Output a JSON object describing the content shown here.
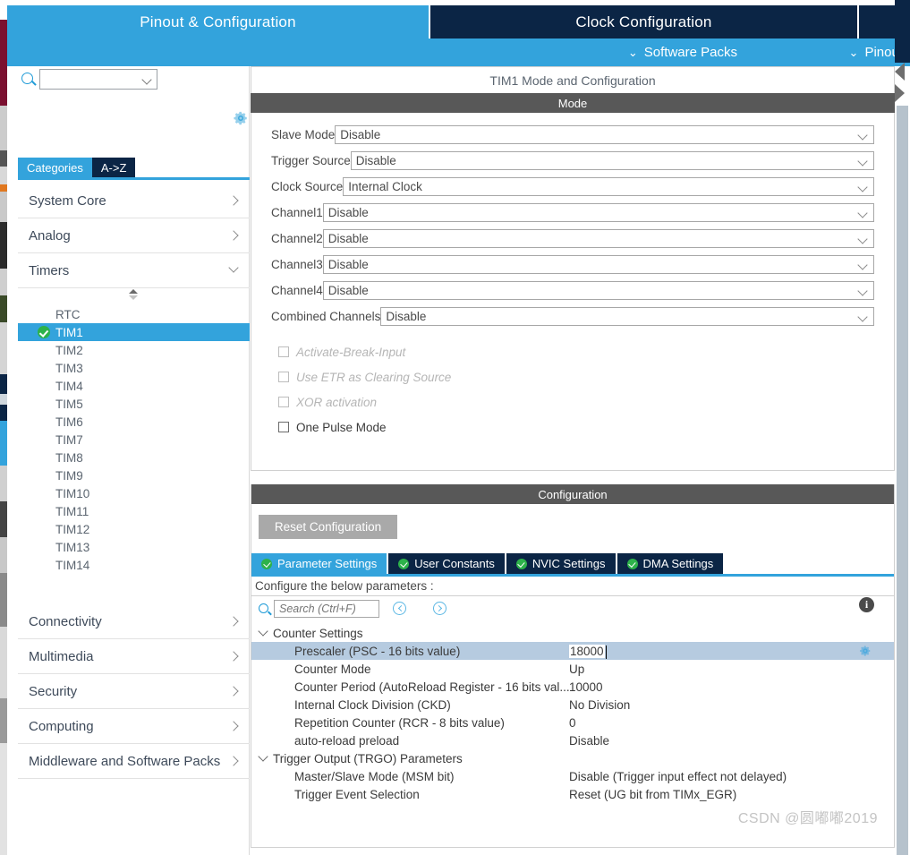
{
  "topbar": {
    "tabs": [
      {
        "label": "Pinout & Configuration",
        "active": true
      },
      {
        "label": "Clock Configuration",
        "active": false
      }
    ],
    "software_packs": "Software Packs",
    "pinout": "Pinout"
  },
  "sidebar": {
    "search_placeholder": "",
    "gear_icon": "gear-icon",
    "view_tabs": [
      {
        "label": "Categories",
        "active": true
      },
      {
        "label": "A->Z",
        "active": false
      }
    ],
    "categories_top": [
      {
        "label": "System Core",
        "expanded": false
      },
      {
        "label": "Analog",
        "expanded": false
      },
      {
        "label": "Timers",
        "expanded": true
      }
    ],
    "timers": [
      {
        "label": "RTC",
        "selected": false
      },
      {
        "label": "TIM1",
        "selected": true
      },
      {
        "label": "TIM2",
        "selected": false
      },
      {
        "label": "TIM3",
        "selected": false
      },
      {
        "label": "TIM4",
        "selected": false
      },
      {
        "label": "TIM5",
        "selected": false
      },
      {
        "label": "TIM6",
        "selected": false
      },
      {
        "label": "TIM7",
        "selected": false
      },
      {
        "label": "TIM8",
        "selected": false
      },
      {
        "label": "TIM9",
        "selected": false
      },
      {
        "label": "TIM10",
        "selected": false
      },
      {
        "label": "TIM11",
        "selected": false
      },
      {
        "label": "TIM12",
        "selected": false
      },
      {
        "label": "TIM13",
        "selected": false
      },
      {
        "label": "TIM14",
        "selected": false
      }
    ],
    "categories_bottom": [
      {
        "label": "Connectivity",
        "expanded": false
      },
      {
        "label": "Multimedia",
        "expanded": false
      },
      {
        "label": "Security",
        "expanded": false
      },
      {
        "label": "Computing",
        "expanded": false
      },
      {
        "label": "Middleware and Software Packs",
        "expanded": false
      }
    ]
  },
  "main": {
    "panel_title": "TIM1 Mode and Configuration",
    "mode_section": "Mode",
    "mode_fields": [
      {
        "label": "Slave Mode",
        "value": "Disable"
      },
      {
        "label": "Trigger Source",
        "value": "Disable"
      },
      {
        "label": "Clock Source",
        "value": "Internal Clock"
      },
      {
        "label": "Channel1",
        "value": "Disable"
      },
      {
        "label": "Channel2",
        "value": "Disable"
      },
      {
        "label": "Channel3",
        "value": "Disable"
      },
      {
        "label": "Channel4",
        "value": "Disable"
      },
      {
        "label": "Combined Channels",
        "value": "Disable"
      }
    ],
    "checkboxes": [
      {
        "label": "Activate-Break-Input",
        "checked": false,
        "disabled": true
      },
      {
        "label": "Use ETR as Clearing Source",
        "checked": false,
        "disabled": true
      },
      {
        "label": "XOR activation",
        "checked": false,
        "disabled": true
      },
      {
        "label": "One Pulse Mode",
        "checked": false,
        "disabled": false
      }
    ]
  },
  "configuration": {
    "section_title": "Configuration",
    "reset_button": "Reset Configuration",
    "tabs": [
      {
        "label": "Parameter Settings",
        "active": true
      },
      {
        "label": "User Constants",
        "active": false
      },
      {
        "label": "NVIC Settings",
        "active": false
      },
      {
        "label": "DMA Settings",
        "active": false
      }
    ],
    "configure_hint": "Configure the below parameters :",
    "search_placeholder": "Search (Ctrl+F)",
    "groups": [
      {
        "title": "Counter Settings",
        "expanded": true,
        "params": [
          {
            "name": "Prescaler (PSC - 16 bits value)",
            "value": "18000",
            "highlighted": true,
            "editing": true,
            "gear": true
          },
          {
            "name": "Counter Mode",
            "value": "Up",
            "highlighted": false,
            "editing": false,
            "gear": false
          },
          {
            "name": "Counter Period (AutoReload Register - 16 bits val...",
            "value": "10000",
            "highlighted": false,
            "editing": false,
            "gear": false
          },
          {
            "name": "Internal Clock Division (CKD)",
            "value": "No Division",
            "highlighted": false,
            "editing": false,
            "gear": false
          },
          {
            "name": "Repetition Counter (RCR - 8 bits value)",
            "value": "0",
            "highlighted": false,
            "editing": false,
            "gear": false
          },
          {
            "name": "auto-reload preload",
            "value": "Disable",
            "highlighted": false,
            "editing": false,
            "gear": false
          }
        ]
      },
      {
        "title": "Trigger Output (TRGO) Parameters",
        "expanded": true,
        "params": [
          {
            "name": "Master/Slave Mode (MSM bit)",
            "value": "Disable (Trigger input effect not delayed)",
            "highlighted": false,
            "editing": false,
            "gear": false
          },
          {
            "name": "Trigger Event Selection",
            "value": "Reset (UG bit from TIMx_EGR)",
            "highlighted": false,
            "editing": false,
            "gear": false
          }
        ]
      }
    ]
  },
  "watermark": "CSDN @圆嘟嘟2019",
  "colors": {
    "accent_blue": "#33a3dc",
    "dark_navy": "#0b2545",
    "section_gray": "#585858",
    "row_highlight": "#b6cbe0",
    "check_green": "#2db24a"
  }
}
